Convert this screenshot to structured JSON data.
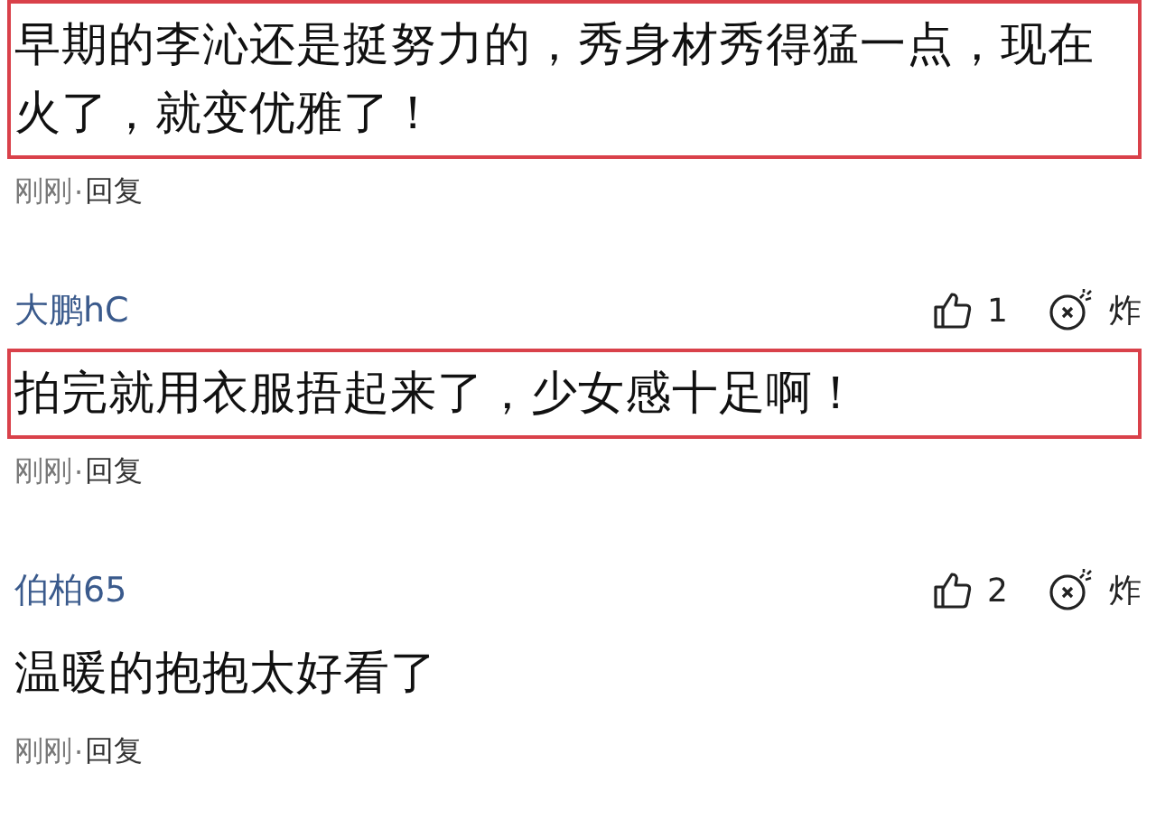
{
  "comments": [
    {
      "text": "早期的李沁还是挺努力的，秀身材秀得猛一点，现在火了，就变优雅了！",
      "highlighted": true,
      "time": "刚刚",
      "separator": "·",
      "reply": "回复"
    },
    {
      "author": "大鹏hC",
      "likes": "1",
      "bomb": "炸",
      "text": "拍完就用衣服捂起来了，少女感十足啊！",
      "highlighted": true,
      "time": "刚刚",
      "separator": "·",
      "reply": "回复"
    },
    {
      "author": "伯柏65",
      "likes": "2",
      "bomb": "炸",
      "text": "温暖的抱抱太好看了",
      "highlighted": false,
      "time": "刚刚",
      "separator": "·",
      "reply": "回复"
    }
  ]
}
